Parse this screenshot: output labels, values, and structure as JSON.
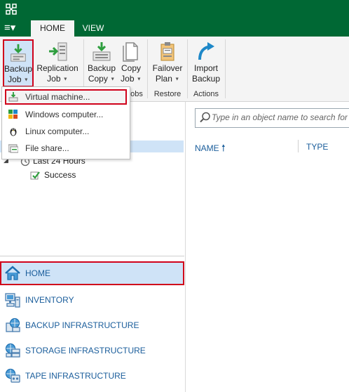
{
  "titlebar": {
    "app_icon": "veeam-icon"
  },
  "menu": {
    "label": "≡▾"
  },
  "tabs": [
    {
      "label": "HOME"
    },
    {
      "label": "VIEW"
    }
  ],
  "ribbon": {
    "buttons": [
      {
        "line1": "Backup",
        "line2": "Job",
        "icon": "backup-job-icon"
      },
      {
        "line1": "Replication",
        "line2": "Job",
        "icon": "replication-job-icon"
      },
      {
        "line1": "Backup",
        "line2": "Copy",
        "icon": "backup-copy-icon"
      },
      {
        "line1": "Copy",
        "line2": "Job",
        "icon": "copy-job-icon"
      },
      {
        "line1": "Failover",
        "line2": "Plan",
        "icon": "failover-plan-icon"
      },
      {
        "line1": "Import",
        "line2": "Backup",
        "icon": "import-backup-icon"
      }
    ],
    "groups": {
      "jobs_fragment": "obs",
      "restore": "Restore",
      "actions": "Actions"
    }
  },
  "dropdown": {
    "items": [
      {
        "label": "Virtual machine...",
        "icon": "virtual-machine-icon"
      },
      {
        "label": "Windows computer...",
        "icon": "windows-computer-icon"
      },
      {
        "label": "Linux computer...",
        "icon": "linux-computer-icon"
      },
      {
        "label": "File share...",
        "icon": "file-share-icon"
      }
    ]
  },
  "tree": {
    "last24": "Last 24 Hours",
    "success": "Success"
  },
  "nav": {
    "items": [
      {
        "label": "HOME",
        "icon": "home-icon"
      },
      {
        "label": "INVENTORY",
        "icon": "inventory-icon"
      },
      {
        "label": "BACKUP INFRASTRUCTURE",
        "icon": "backup-infrastructure-icon"
      },
      {
        "label": "STORAGE INFRASTRUCTURE",
        "icon": "storage-infrastructure-icon"
      },
      {
        "label": "TAPE INFRASTRUCTURE",
        "icon": "tape-infrastructure-icon"
      }
    ]
  },
  "search": {
    "placeholder": "Type in an object name to search for"
  },
  "table": {
    "columns": [
      {
        "label": "NAME",
        "sort": "ascending"
      },
      {
        "label": "TYPE"
      }
    ]
  },
  "colors": {
    "titlebar": "#006834",
    "accent_blue": "#1a5d9b",
    "selection": "#cfe3f7",
    "highlight_border": "#d0021b"
  }
}
